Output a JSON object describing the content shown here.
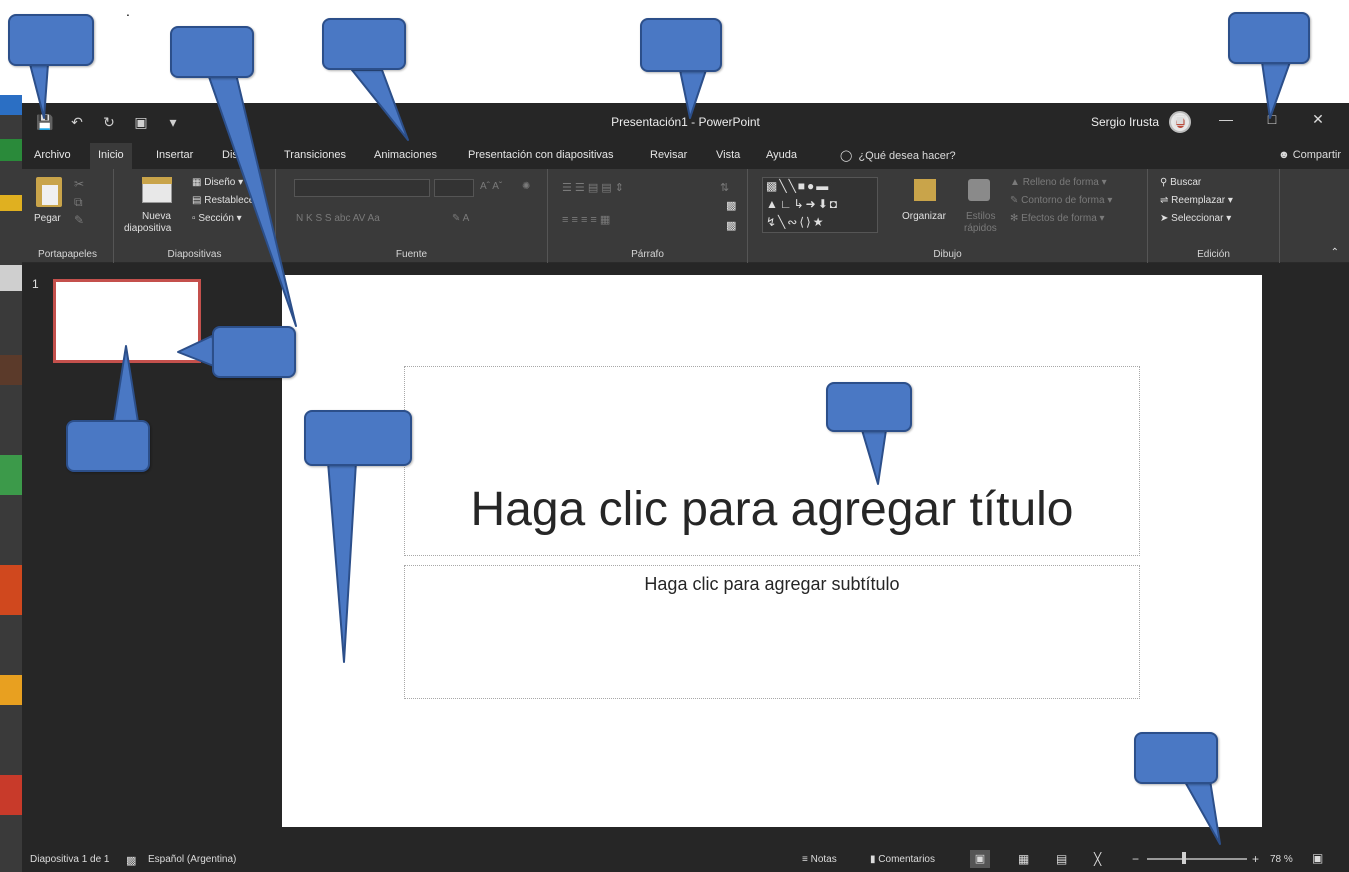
{
  "qat": {
    "save_icon": "save-icon",
    "undo_icon": "undo-icon",
    "redo_icon": "redo-icon",
    "present_icon": "present-icon",
    "customize_icon": "customize-qat-icon"
  },
  "titlebar": {
    "title": "Presentación1 - PowerPoint",
    "user": "Sergio Irusta",
    "controls": [
      "display-options-icon",
      "minimize-icon",
      "restore-icon",
      "close-icon"
    ]
  },
  "tabs": [
    {
      "label": "Archivo"
    },
    {
      "label": "Inicio",
      "active": true
    },
    {
      "label": "Insertar"
    },
    {
      "label": "Diseño"
    },
    {
      "label": "Transiciones"
    },
    {
      "label": "Animaciones"
    },
    {
      "label": "Presentación con diapositivas"
    },
    {
      "label": "Revisar"
    },
    {
      "label": "Vista"
    },
    {
      "label": "Ayuda"
    }
  ],
  "tell_me": "¿Qué desea hacer?",
  "share": "Compartir",
  "ribbon": {
    "portapapeles": {
      "paste": "Pegar",
      "label": "Portapapeles"
    },
    "diapositivas": {
      "new_slide_line1": "Nueva",
      "new_slide_line2": "diapositiva",
      "layout": "Diseño",
      "reset": "Restablecer",
      "section": "Sección",
      "label": "Diapositivas"
    },
    "fuente": {
      "label": "Fuente",
      "format_text": "N K S S abc AV Aa"
    },
    "parrafo": {
      "label": "Párrafo"
    },
    "dibujo": {
      "arrange": "Organizar",
      "quick_styles_line1": "Estilos",
      "quick_styles_line2": "rápidos",
      "fill": "Relleno de forma",
      "outline": "Contorno de forma",
      "effects": "Efectos de forma",
      "label": "Dibujo"
    },
    "edicion": {
      "find": "Buscar",
      "replace": "Reemplazar",
      "select": "Seleccionar",
      "label": "Edición"
    }
  },
  "thumbnails": {
    "slide_number": "1"
  },
  "slide": {
    "title_placeholder": "Haga clic para agregar título",
    "subtitle_placeholder": "Haga clic para agregar subtítulo"
  },
  "statusbar": {
    "slide_info": "Diapositiva 1 de 1",
    "language": "Español (Argentina)",
    "notes": "Notas",
    "comments": "Comentarios",
    "zoom": "78 %"
  },
  "callout_color": "#4a78c4",
  "accent_thumb": "#c4504c"
}
